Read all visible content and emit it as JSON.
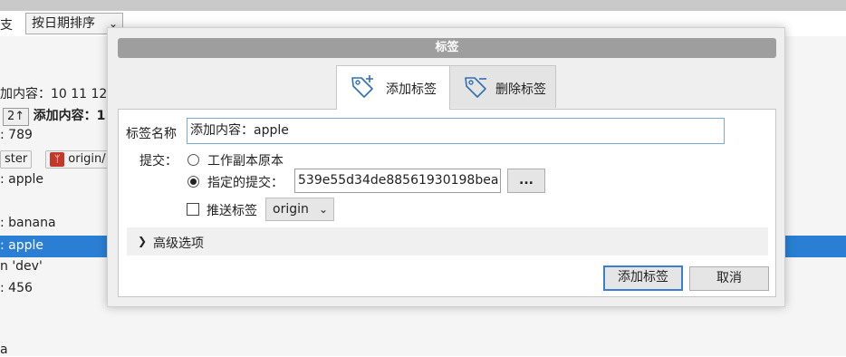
{
  "background": {
    "branch_fragment": "支",
    "sort_select": "按日期排序",
    "lines": {
      "content_label": "加内容：10 11 12",
      "badge_num": "2↑",
      "bold_text": "添加内容：1",
      "line_789": ": 789",
      "branch_master": "ster",
      "branch_origin": "origin/",
      "remote_icon": "ᛘ",
      "line_apple1": ": apple",
      "line_banana": ": banana",
      "line_apple_sel": ": apple",
      "line_dev": "n 'dev'",
      "line_456": ": 456",
      "line_last": "a"
    }
  },
  "dialog": {
    "title": "标签",
    "tabs": [
      {
        "label": "添加标签",
        "icon": "tag-add-icon",
        "active": true
      },
      {
        "label": "删除标签",
        "icon": "tag-remove-icon",
        "active": false
      }
    ],
    "tag_name_label": "标签名称",
    "tag_name_value": "添加内容：apple",
    "commit_label": "提交：",
    "option_working_copy": "工作副本原本",
    "option_specified_commit": "指定的提交：",
    "commit_hash": "539e55d34de88561930198bea",
    "browse_button": "...",
    "push_tag_label": "推送标签",
    "remote_select": "origin",
    "advanced_label": "高级选项",
    "add_button": "添加标签",
    "cancel_button": "取消"
  },
  "colors": {
    "selection": "#2a7fd4",
    "title_bar": "#9e9e9e",
    "primary_border": "#3c7fd1"
  }
}
